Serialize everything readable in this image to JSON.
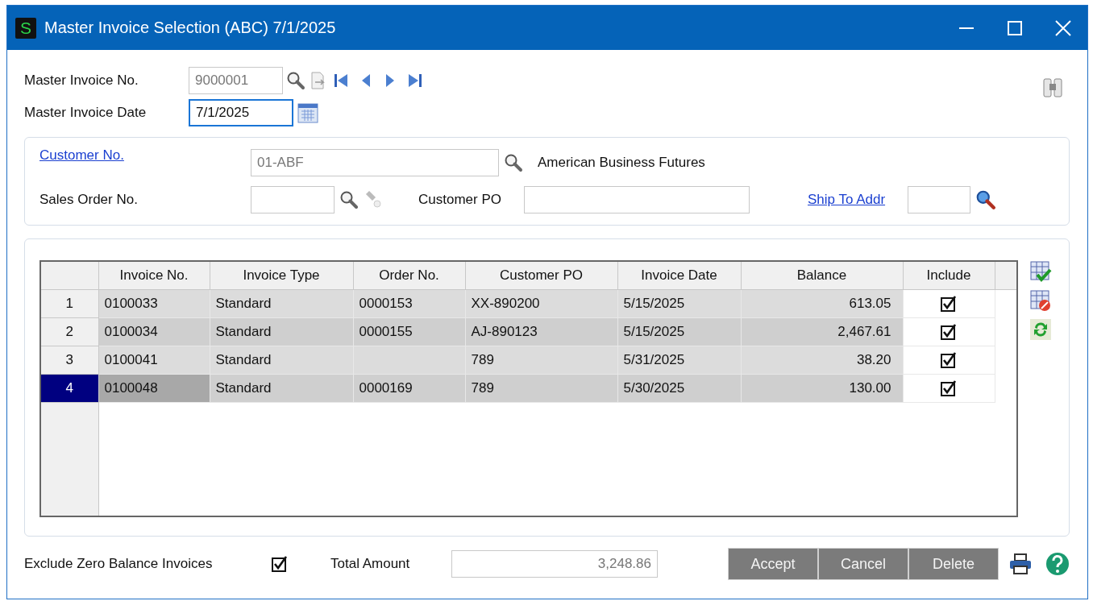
{
  "window": {
    "title": "Master Invoice Selection (ABC) 7/1/2025",
    "app_badge": "S"
  },
  "header": {
    "invoice_no_label": "Master Invoice No.",
    "invoice_no": "9000001",
    "invoice_date_label": "Master Invoice Date",
    "invoice_date": "7/1/2025"
  },
  "customer": {
    "customer_no_label": "Customer No.",
    "customer_no": "01-ABF",
    "customer_name": "American Business Futures",
    "sales_order_label": "Sales Order No.",
    "customer_po_label": "Customer PO",
    "ship_to_label": "Ship To Addr"
  },
  "table": {
    "columns": [
      "Invoice No.",
      "Invoice Type",
      "Order No.",
      "Customer PO",
      "Invoice Date",
      "Balance",
      "Include"
    ],
    "rows": [
      {
        "number": "1",
        "cells": [
          "0100033",
          "Standard",
          "0000153",
          "XX-890200",
          "5/15/2025",
          "613.05"
        ],
        "include": true,
        "selected": false
      },
      {
        "number": "2",
        "cells": [
          "0100034",
          "Standard",
          "0000155",
          "AJ-890123",
          "5/15/2025",
          "2,467.61"
        ],
        "include": true,
        "selected": false
      },
      {
        "number": "3",
        "cells": [
          "0100041",
          "Standard",
          "",
          "789",
          "5/31/2025",
          "38.20"
        ],
        "include": true,
        "selected": false
      },
      {
        "number": "4",
        "cells": [
          "0100048",
          "Standard",
          "0000169",
          "789",
          "5/30/2025",
          "130.00"
        ],
        "include": true,
        "selected": true
      }
    ]
  },
  "footer": {
    "exclude_label": "Exclude Zero Balance Invoices",
    "exclude_checked": true,
    "total_label": "Total Amount",
    "total": "3,248.86",
    "buttons": [
      {
        "label": "Accept"
      },
      {
        "label": "Cancel"
      },
      {
        "label": "Delete"
      }
    ]
  }
}
